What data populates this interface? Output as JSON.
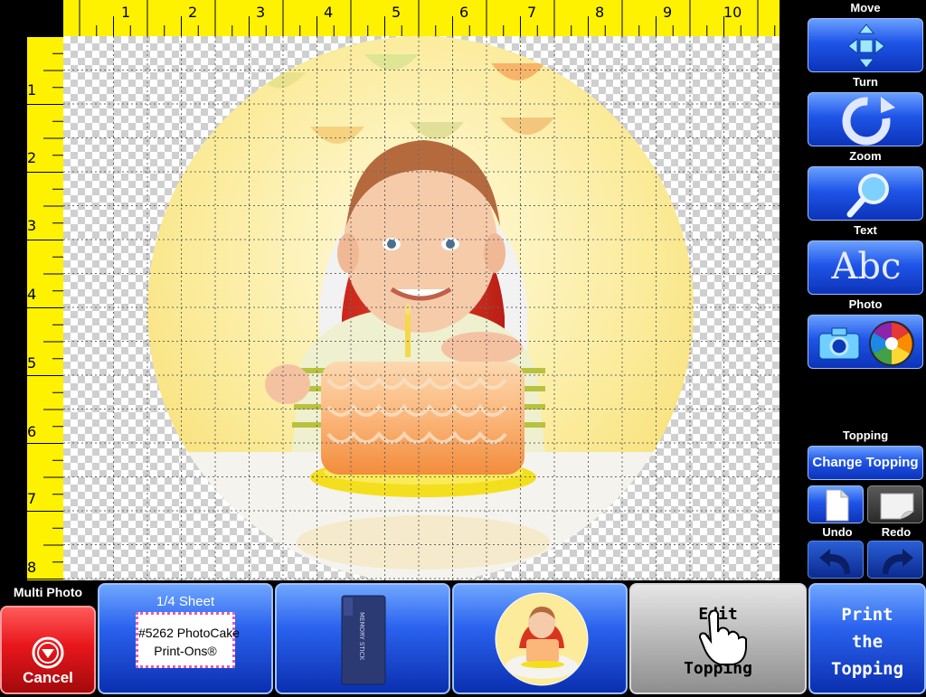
{
  "ruler": {
    "top": [
      "1",
      "2",
      "3",
      "4",
      "5",
      "6",
      "7",
      "8",
      "9",
      "10"
    ],
    "left": [
      "1",
      "2",
      "3",
      "4",
      "5",
      "6",
      "7",
      "8"
    ]
  },
  "tools": {
    "move_label": "Move",
    "turn_label": "Turn",
    "zoom_label": "Zoom",
    "text_label": "Text",
    "text_icon_text": "Abc",
    "photo_label": "Photo",
    "topping_label": "Topping",
    "change_topping_label": "Change Topping",
    "undo_label": "Undo",
    "redo_label": "Redo"
  },
  "bottom": {
    "multi_photo_label": "Multi Photo",
    "cancel_label": "Cancel",
    "sheet_label": "1/4 Sheet",
    "sheet_line1": "#5262 PhotoCake",
    "sheet_line2": "Print-Ons®",
    "edit_line1": "Edit",
    "edit_line2": "the",
    "edit_line3": "Topping",
    "print_line1": "Print",
    "print_line2": "the",
    "print_line3": "Topping"
  },
  "colors": {
    "ruler": "#fff200",
    "button_blue": "#1f55e8",
    "cancel_red": "#e8161b"
  },
  "icons": {
    "move": "move-arrows-icon",
    "turn": "rotate-icon",
    "zoom": "magnifier-icon",
    "camera": "camera-icon",
    "aperture": "aperture-icon",
    "new_page": "blank-page-icon",
    "curled_page": "curled-page-icon",
    "undo": "undo-arrow-icon",
    "redo": "redo-arrow-icon",
    "cancel": "stop-icon",
    "memory_card": "memory-card-icon",
    "hand_cursor": "hand-pointer-icon"
  }
}
